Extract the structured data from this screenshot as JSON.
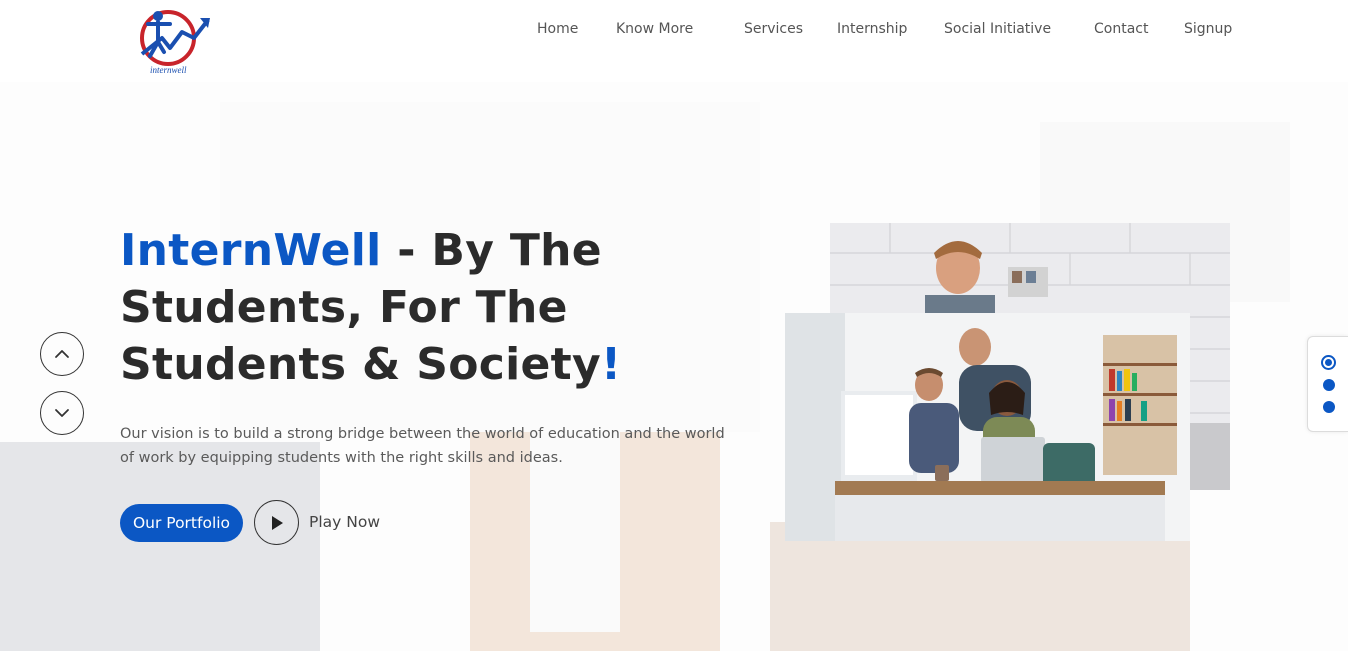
{
  "brand": {
    "logo_text": "internwell"
  },
  "nav": {
    "items": [
      "Home",
      "Know More",
      "Services",
      "Internship",
      "Social Initiative",
      "Contact",
      "Signup"
    ]
  },
  "hero": {
    "title_brand": "InternWell",
    "title_rest_1": " - By The",
    "title_line_2": "Students, For The",
    "title_line_3": "Students & Society",
    "title_bang": "!",
    "description": "Our vision is to build a strong bridge between the world of education and the world of work by equipping students with the right skills and ideas.",
    "primary_button": "Our Portfolio",
    "play_label": "Play Now"
  },
  "slider": {
    "slide_count": 3,
    "active_slide": 1
  },
  "colors": {
    "accent": "#0b57c4",
    "text_dark": "#2b2b2b",
    "logo_red": "#c8242b"
  },
  "icons": [
    "logo-icon",
    "chevron-up-icon",
    "chevron-down-icon",
    "play-icon"
  ]
}
